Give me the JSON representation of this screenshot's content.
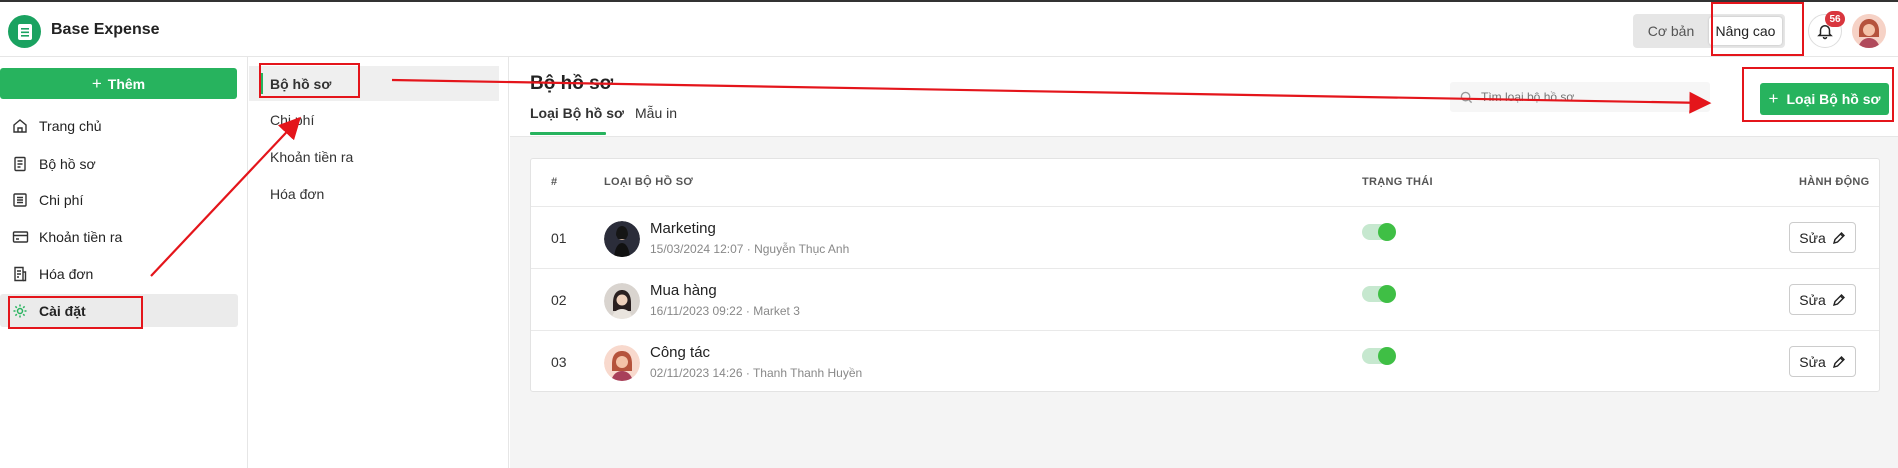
{
  "app": {
    "title": "Base Expense"
  },
  "header": {
    "mode_basic": "Cơ bản",
    "mode_advanced": "Nâng cao",
    "notification_count": "56"
  },
  "sidebar": {
    "add_label": "Thêm",
    "items": [
      {
        "label": "Trang chủ",
        "icon": "home-icon"
      },
      {
        "label": "Bộ hồ sơ",
        "icon": "document-icon"
      },
      {
        "label": "Chi phí",
        "icon": "list-icon"
      },
      {
        "label": "Khoản tiền ra",
        "icon": "card-icon"
      },
      {
        "label": "Hóa đơn",
        "icon": "invoice-icon"
      },
      {
        "label": "Cài đặt",
        "icon": "gear-icon"
      }
    ]
  },
  "subnav": {
    "items": [
      {
        "label": "Bộ hồ sơ"
      },
      {
        "label": "Chi phí"
      },
      {
        "label": "Khoản tiền ra"
      },
      {
        "label": "Hóa đơn"
      }
    ]
  },
  "main": {
    "title": "Bộ hồ sơ",
    "tabs": [
      {
        "label": "Loại Bộ hồ sơ"
      },
      {
        "label": "Mẫu in"
      }
    ],
    "search_placeholder": "Tìm loại bộ hồ sơ",
    "primary_button": "Loại Bộ hồ sơ",
    "table": {
      "headers": {
        "index": "#",
        "type": "LOẠI BỘ HỒ SƠ",
        "status": "TRẠNG THÁI",
        "action": "HÀNH ĐỘNG"
      },
      "rows": [
        {
          "index": "01",
          "name": "Marketing",
          "meta": "15/03/2024 12:07 · Nguyễn Thục Anh",
          "status": "on",
          "action": "Sửa"
        },
        {
          "index": "02",
          "name": "Mua hàng",
          "meta": "16/11/2023 09:22 · Market 3",
          "status": "on",
          "action": "Sửa"
        },
        {
          "index": "03",
          "name": "Công tác",
          "meta": "02/11/2023 14:26 · Thanh Thanh Huyền",
          "status": "on",
          "action": "Sửa"
        }
      ]
    }
  },
  "colors": {
    "brand_green": "#27b35e",
    "toggle_on": "#3fbf45",
    "annotation_red": "#e4151b",
    "badge_red": "#d9363e"
  }
}
